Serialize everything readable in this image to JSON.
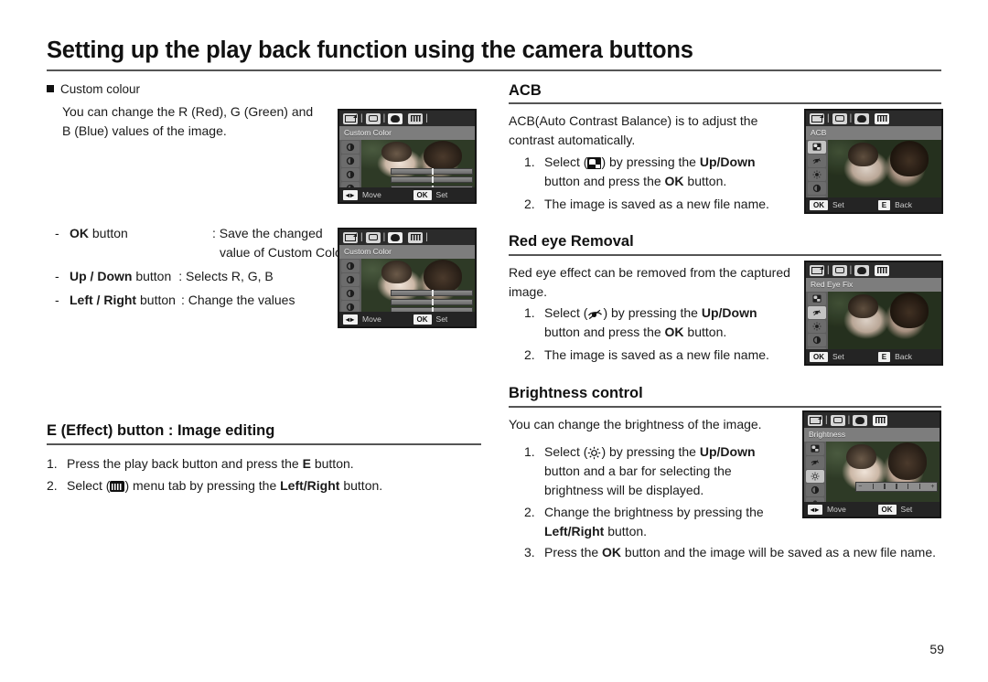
{
  "header": {
    "title": "Setting up the play back function using the camera buttons"
  },
  "page_number": "59",
  "left_column": {
    "custom_colour": {
      "heading": "Custom colour",
      "paragraph_line1": "You can change the R (Red), G (Green) and",
      "paragraph_line2": "B (Blue) values of the image.",
      "rows": [
        {
          "dash": "-",
          "key": "OK",
          "key_suffix": " button",
          "value_line1": ": Save the changed",
          "value_line2": "value of Custom Color"
        },
        {
          "dash": "-",
          "key": "Up / Down",
          "key_suffix": " button",
          "value_line1": ": Selects R, G, B",
          "value_line2": ""
        },
        {
          "dash": "-",
          "key": "Left / Right",
          "key_suffix": " button",
          "value_line1": ": Change the values",
          "value_line2": ""
        }
      ]
    },
    "effect_button": {
      "heading": "E (Effect) button : Image editing",
      "steps": [
        {
          "num": "1.",
          "pre": "Press the play back button and press the ",
          "bold": "E",
          "post": " button."
        },
        {
          "num": "2.",
          "pre": "Select (",
          "icon": "effect-menu-tab-icon",
          "mid": ") menu tab by pressing the ",
          "bold": "Left/Right",
          "post": " button."
        }
      ]
    }
  },
  "right_column": {
    "acb": {
      "heading": "ACB",
      "paragraph_line1": "ACB(Auto Contrast Balance) is to adjust the",
      "paragraph_line2": "contrast automatically.",
      "steps": [
        {
          "num": "1.",
          "pre": "Select (",
          "icon": "acb-icon",
          "mid": ") by pressing the ",
          "bold": "Up/Down",
          "line2_pre": "button and press the ",
          "line2_bold": "OK",
          "line2_post": " button."
        },
        {
          "num": "2.",
          "pre": "The image is saved as a new file name."
        }
      ]
    },
    "red_eye": {
      "heading": "Red eye Removal",
      "paragraph_line1": "Red eye effect can be removed from the captured",
      "paragraph_line2": "image.",
      "steps": [
        {
          "num": "1.",
          "pre": "Select (",
          "icon": "red-eye-icon",
          "mid": ") by pressing the ",
          "bold": "Up/Down",
          "line2_pre": "button and press the ",
          "line2_bold": "OK",
          "line2_post": " button."
        },
        {
          "num": "2.",
          "pre": "The image is saved as a new file name."
        }
      ]
    },
    "brightness": {
      "heading": "Brightness control",
      "paragraph_line1": "You can change the brightness of the image.",
      "steps": [
        {
          "num": "1.",
          "pre": "Select (",
          "icon": "brightness-sun-icon",
          "mid": ") by pressing the ",
          "bold": "Up/Down",
          "line2": "button and a bar for selecting the",
          "line3": "brightness will be displayed."
        },
        {
          "num": "2.",
          "pre": "Change the brightness by pressing the",
          "line2_bold": "Left/Right",
          "line2_post": " button."
        },
        {
          "num": "3.",
          "pre": "Press the ",
          "bold": "OK",
          "post": " button and the image will be saved as a new file name."
        }
      ]
    }
  },
  "lcd_screens": [
    {
      "id": "custom-color-1",
      "title": "Custom Color",
      "tabs": [
        "image-tab-icon",
        "camera-tab-icon",
        "palette-tab-icon",
        "effect-tab-icon"
      ],
      "selected_tab_index": 2,
      "rail_count": 6,
      "rail_selected_index": 5,
      "footer": [
        {
          "key": "◂▸",
          "label": "Move"
        },
        {
          "key": "OK",
          "label": "Set"
        }
      ]
    },
    {
      "id": "custom-color-2",
      "title": "Custom Color",
      "tabs": [
        "image-tab-icon",
        "camera-tab-icon",
        "palette-tab-icon",
        "effect-tab-icon"
      ],
      "selected_tab_index": 2,
      "rail_count": 6,
      "rail_selected_index": 5,
      "footer": [
        {
          "key": "◂▸",
          "label": "Move"
        },
        {
          "key": "OK",
          "label": "Set"
        }
      ]
    },
    {
      "id": "acb",
      "title": "ACB",
      "tabs": [
        "image-tab-icon",
        "camera-tab-icon",
        "palette-tab-icon",
        "effect-tab-icon"
      ],
      "selected_tab_index": 3,
      "rail_count": 5,
      "rail_selected_index": 0,
      "footer": [
        {
          "key": "OK",
          "label": "Set"
        },
        {
          "key": "E",
          "label": "Back"
        }
      ]
    },
    {
      "id": "red-eye-fix",
      "title": "Red Eye Fix",
      "tabs": [
        "image-tab-icon",
        "camera-tab-icon",
        "palette-tab-icon",
        "effect-tab-icon"
      ],
      "selected_tab_index": 3,
      "rail_count": 5,
      "rail_selected_index": 1,
      "footer": [
        {
          "key": "OK",
          "label": "Set"
        },
        {
          "key": "E",
          "label": "Back"
        }
      ]
    },
    {
      "id": "brightness",
      "title": "Brightness",
      "tabs": [
        "image-tab-icon",
        "camera-tab-icon",
        "palette-tab-icon",
        "effect-tab-icon"
      ],
      "selected_tab_index": 3,
      "rail_count": 5,
      "rail_selected_index": 2,
      "footer": [
        {
          "key": "◂▸",
          "label": "Move"
        },
        {
          "key": "OK",
          "label": "Set"
        }
      ]
    }
  ]
}
